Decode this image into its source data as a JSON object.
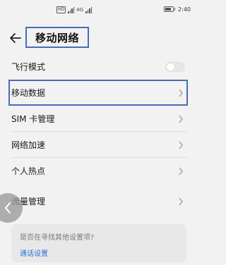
{
  "status_bar": {
    "hd_badge": "HD",
    "network_label": "4G",
    "time": "2:40",
    "battery_level": 0.6
  },
  "header": {
    "title": "移动网络"
  },
  "settings": [
    {
      "label": "飞行模式",
      "type": "toggle",
      "on": false
    },
    {
      "label": "移动数据",
      "type": "link"
    },
    {
      "label": "SIM 卡管理",
      "type": "link"
    },
    {
      "label": "网络加速",
      "type": "link"
    },
    {
      "label": "个人热点",
      "type": "link"
    },
    {
      "label": "流量管理",
      "type": "link"
    }
  ],
  "suggestion": {
    "question": "是否在寻找其他设置项?",
    "link": "通话设置"
  },
  "colors": {
    "highlight_border": "#4a6db0",
    "link_blue": "#2f6fcf"
  }
}
